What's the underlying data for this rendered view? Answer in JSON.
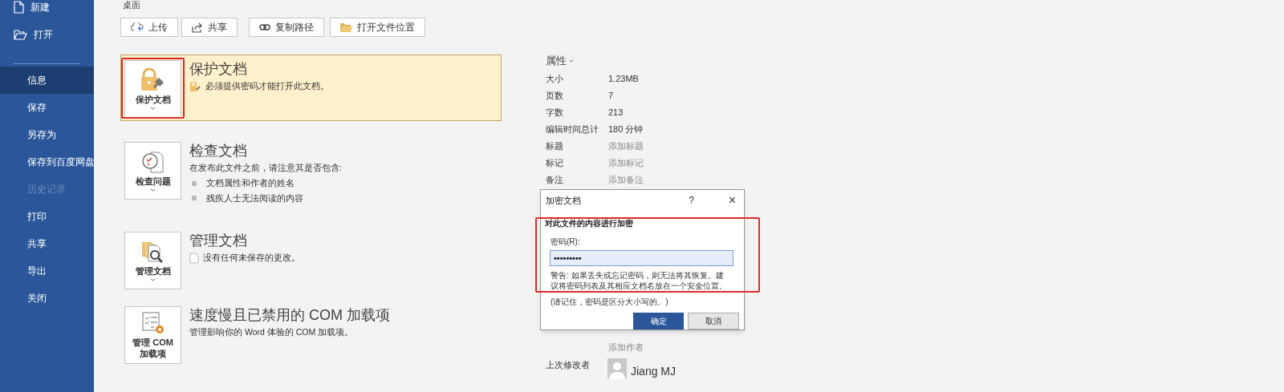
{
  "sidebar": {
    "items": [
      {
        "label": "新建",
        "selected": false,
        "disabled": false
      },
      {
        "label": "打开",
        "selected": false,
        "disabled": false
      },
      {
        "label": "信息",
        "selected": true,
        "disabled": false
      },
      {
        "label": "保存",
        "selected": false,
        "disabled": false
      },
      {
        "label": "另存为",
        "selected": false,
        "disabled": false
      },
      {
        "label": "保存到百度网盘",
        "selected": false,
        "disabled": false
      },
      {
        "label": "历史记录",
        "selected": false,
        "disabled": true
      },
      {
        "label": "打印",
        "selected": false,
        "disabled": false
      },
      {
        "label": "共享",
        "selected": false,
        "disabled": false
      },
      {
        "label": "导出",
        "selected": false,
        "disabled": false
      },
      {
        "label": "关闭",
        "selected": false,
        "disabled": false
      }
    ]
  },
  "location": "桌面",
  "action_buttons": [
    {
      "label": "上传"
    },
    {
      "label": "共享"
    },
    {
      "label": "复制路径"
    },
    {
      "label": "打开文件位置"
    }
  ],
  "sections": [
    {
      "kind": "protect",
      "title": "保护文档",
      "button_label": "保护文档",
      "has_menu": true,
      "alert": true,
      "highlighted": true,
      "description": "必须提供密码才能打开此文档。"
    },
    {
      "kind": "inspect",
      "title": "检查文档",
      "button_label": "检查问题",
      "has_menu": true,
      "alert": false,
      "highlighted": false,
      "description": "在发布此文件之前，请注意其是否包含:",
      "bullets": [
        "文档属性和作者的姓名",
        "残疾人士无法阅读的内容"
      ]
    },
    {
      "kind": "manage",
      "title": "管理文档",
      "button_label": "管理文档",
      "has_menu": true,
      "alert": false,
      "highlighted": false,
      "description": "没有任何未保存的更改。"
    },
    {
      "kind": "com",
      "title": "速度慢且已禁用的 COM 加载项",
      "button_label": "管理 COM 加载项",
      "has_menu": false,
      "alert": false,
      "highlighted": false,
      "description": "管理影响你的 Word 体验的 COM 加载项。"
    }
  ],
  "properties": {
    "heading": "属性",
    "rows": [
      {
        "label": "大小",
        "value": "1.23MB"
      },
      {
        "label": "页数",
        "value": "7"
      },
      {
        "label": "字数",
        "value": "213"
      },
      {
        "label": "编辑时间总计",
        "value": "180 分钟"
      },
      {
        "label": "标题",
        "placeholder": "添加标题"
      },
      {
        "label": "标记",
        "placeholder": "添加标记"
      },
      {
        "label": "备注",
        "placeholder": "添加备注"
      }
    ],
    "add_author": "添加作者",
    "last_modified_label": "上次修改者",
    "last_modified_name": "Jiang MJ"
  },
  "dialog": {
    "title": "加密文档",
    "help": "?",
    "close": "×",
    "heading": "对此文件的内容进行加密",
    "field_label": "密码(R):",
    "password": "•••••••••",
    "warning": "警告: 如果丢失或忘记密码，则无法将其恢复。建议将密码列表及其相应文档名放在一个安全位置。",
    "reminder": "(请记住，密码是区分大小写的。)",
    "ok": "确定",
    "cancel": "取消",
    "highlighted": true
  }
}
